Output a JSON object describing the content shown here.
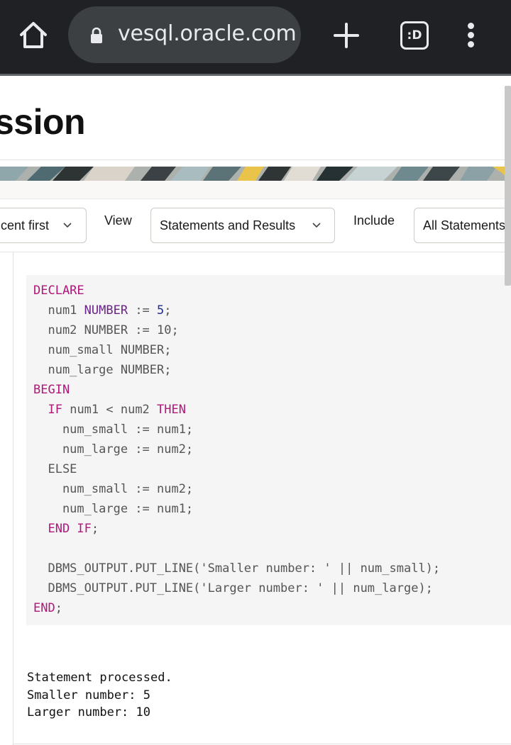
{
  "browser": {
    "url": "vesql.oracle.com",
    "tabs_badge": ":D",
    "icons": [
      "home-icon",
      "lock-icon",
      "plus-icon",
      "tab-switcher-icon",
      "kebab-menu-icon"
    ]
  },
  "page": {
    "title": "ssion"
  },
  "filters": {
    "order": {
      "value": "cent first"
    },
    "view": {
      "label": "View",
      "value": "Statements and Results"
    },
    "include": {
      "label": "Include",
      "value": "All Statements"
    }
  },
  "code": {
    "lines": [
      "DECLARE",
      "  num1 NUMBER := 5;",
      "  num2 NUMBER := 10;",
      "  num_small NUMBER;",
      "  num_large NUMBER;",
      "BEGIN",
      "  IF num1 < num2 THEN",
      "    num_small := num1;",
      "    num_large := num2;",
      "  ELSE",
      "    num_small := num2;",
      "    num_large := num1;",
      "  END IF;",
      "",
      "  DBMS_OUTPUT.PUT_LINE('Smaller number: ' || num_small);",
      "  DBMS_OUTPUT.PUT_LINE('Larger number: ' || num_large);",
      "END;"
    ]
  },
  "output": {
    "lines": [
      "Statement processed.",
      "Smaller number: 5",
      "Larger number: 10"
    ]
  },
  "colors": {
    "chrome": "#202124",
    "keyword": "#b0177a",
    "type": "#6b2288",
    "number": "#1e2d8f",
    "code_bg": "#f5f5f5"
  }
}
